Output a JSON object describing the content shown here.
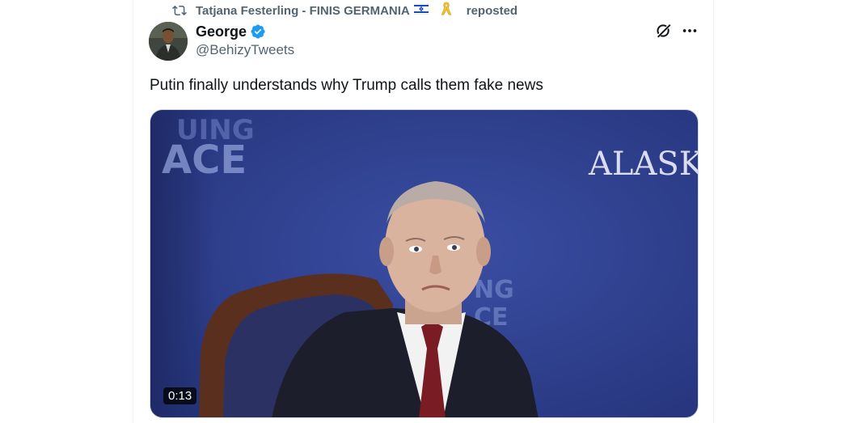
{
  "repost": {
    "icon": "repost-icon",
    "user": "Tatjana Festerling - FINIS GERMANIA",
    "label": "reposted"
  },
  "author": {
    "name": "George",
    "handle": "@BehizyTweets",
    "verified": true
  },
  "tweet": {
    "text": "Putin finally understands why Trump calls them fake news"
  },
  "media": {
    "backdrop_text_1": "UING",
    "backdrop_text_2": "ACE",
    "backdrop_text_3": "ALASKA",
    "backdrop_text_4": "NG",
    "backdrop_text_5": "CE",
    "duration": "0:13"
  },
  "colors": {
    "accent": "#1d9bf0",
    "secondary_text": "#536471",
    "backdrop": "#2e3f8f"
  }
}
